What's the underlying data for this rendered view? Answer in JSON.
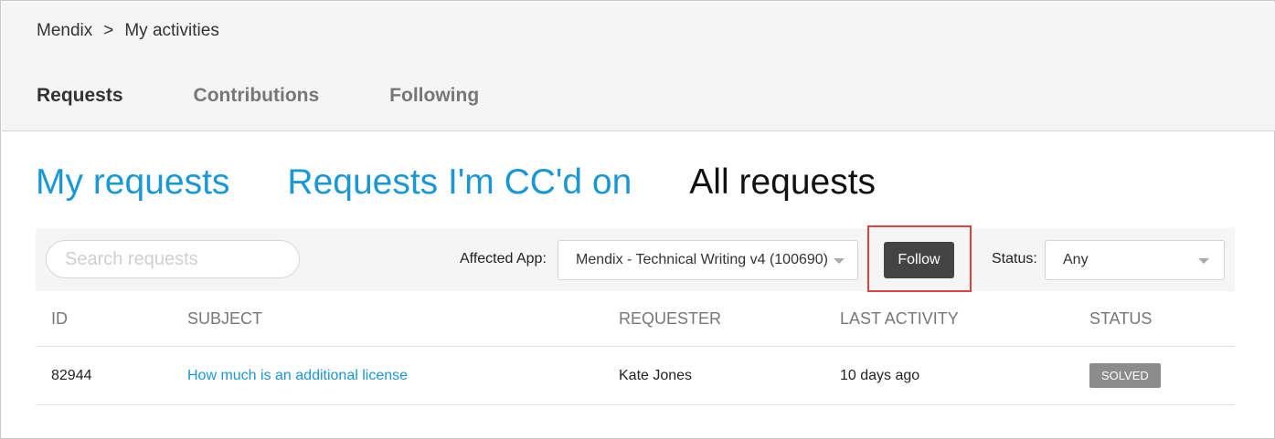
{
  "breadcrumb": {
    "root": "Mendix",
    "separator": ">",
    "current": "My activities"
  },
  "nav_tabs": [
    {
      "label": "Requests",
      "active": true
    },
    {
      "label": "Contributions",
      "active": false
    },
    {
      "label": "Following",
      "active": false
    }
  ],
  "request_tabs": [
    {
      "label": "My requests",
      "active": false
    },
    {
      "label": "Requests I'm CC'd on",
      "active": false
    },
    {
      "label": "All requests",
      "active": true
    }
  ],
  "filters": {
    "search_placeholder": "Search requests",
    "search_value": "",
    "affected_app_label": "Affected App:",
    "affected_app_value": "Mendix - Technical Writing v4 (100690)",
    "follow_label": "Follow",
    "status_label": "Status:",
    "status_value": "Any"
  },
  "table": {
    "columns": [
      "ID",
      "SUBJECT",
      "REQUESTER",
      "LAST ACTIVITY",
      "STATUS"
    ],
    "rows": [
      {
        "id": "82944",
        "subject": "How much is an additional license",
        "requester": "Kate Jones",
        "last_activity": "10 days ago",
        "status": "SOLVED"
      }
    ]
  },
  "colors": {
    "link": "#1a97d5",
    "follow_button": "#444444",
    "highlight": "#e0403e",
    "status_badge": "#8c8c8c"
  },
  "icons": {
    "dropdown": "chevron-down-icon"
  }
}
